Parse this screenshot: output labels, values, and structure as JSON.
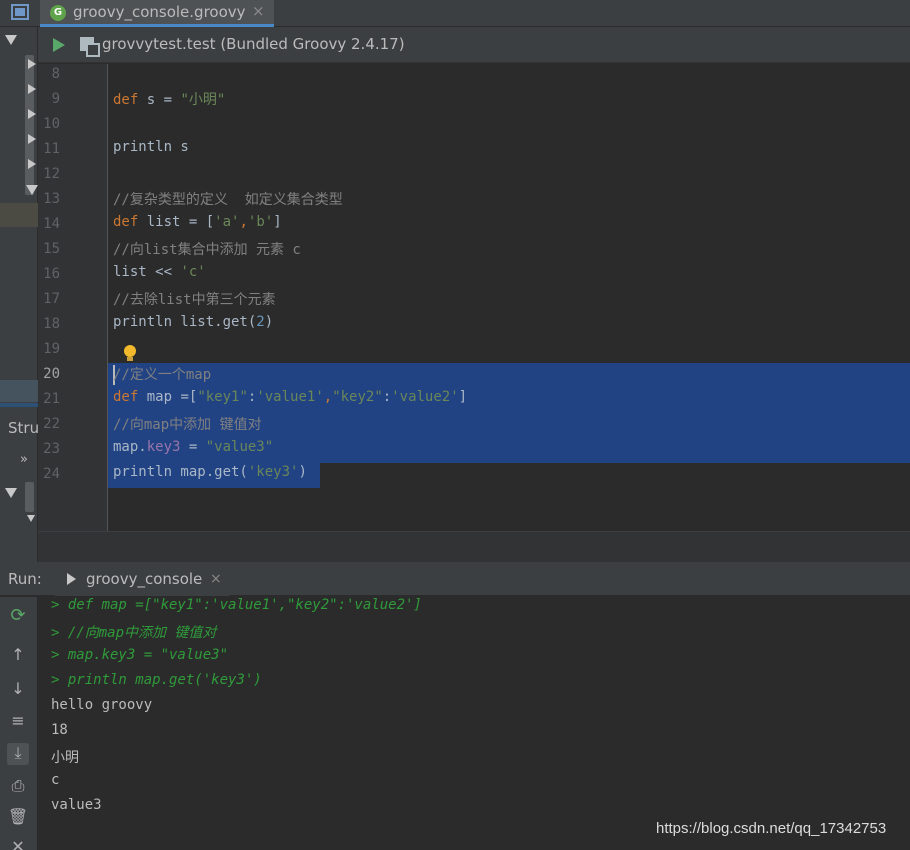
{
  "window": {
    "tab_title": "groovy_console.groovy",
    "tab_close": "×"
  },
  "run_config": {
    "label": "grovvytest.test (Bundled Groovy 2.4.17)"
  },
  "left_panel": {
    "structure_label": "Stru",
    "chevron": "»"
  },
  "editor": {
    "lines": [
      {
        "num": "8",
        "tokens": []
      },
      {
        "num": "9",
        "tokens": [
          {
            "t": "def",
            "c": "kw"
          },
          {
            "t": " s = ",
            "c": ""
          },
          {
            "t": "\"小明\"",
            "c": "str"
          }
        ]
      },
      {
        "num": "10",
        "tokens": []
      },
      {
        "num": "11",
        "tokens": [
          {
            "t": "println s",
            "c": ""
          }
        ]
      },
      {
        "num": "12",
        "tokens": []
      },
      {
        "num": "13",
        "tokens": [
          {
            "t": "//复杂类型的定义  如定义集合类型",
            "c": "cmt"
          }
        ]
      },
      {
        "num": "14",
        "tokens": [
          {
            "t": "def",
            "c": "kw"
          },
          {
            "t": " list = [",
            "c": ""
          },
          {
            "t": "'a'",
            "c": "str"
          },
          {
            "t": ",",
            "c": "kw"
          },
          {
            "t": "'b'",
            "c": "str"
          },
          {
            "t": "]",
            "c": ""
          }
        ]
      },
      {
        "num": "15",
        "tokens": [
          {
            "t": "//向list集合中添加 元素 c",
            "c": "cmt"
          }
        ]
      },
      {
        "num": "16",
        "tokens": [
          {
            "t": "list << ",
            "c": ""
          },
          {
            "t": "'c'",
            "c": "str"
          }
        ]
      },
      {
        "num": "17",
        "tokens": [
          {
            "t": "//去除list中第三个元素",
            "c": "cmt"
          }
        ]
      },
      {
        "num": "18",
        "tokens": [
          {
            "t": "println list.get(",
            "c": ""
          },
          {
            "t": "2",
            "c": "num"
          },
          {
            "t": ")",
            "c": ""
          }
        ]
      },
      {
        "num": "19",
        "tokens": []
      },
      {
        "num": "20",
        "tokens": [
          {
            "t": "//定义一个map",
            "c": "cmt"
          }
        ]
      },
      {
        "num": "21",
        "tokens": [
          {
            "t": "def",
            "c": "kw"
          },
          {
            "t": " map =[",
            "c": ""
          },
          {
            "t": "\"key1\"",
            "c": "str"
          },
          {
            "t": ":",
            "c": ""
          },
          {
            "t": "'value1'",
            "c": "str"
          },
          {
            "t": ",",
            "c": "kw"
          },
          {
            "t": "\"key2\"",
            "c": "str"
          },
          {
            "t": ":",
            "c": ""
          },
          {
            "t": "'value2'",
            "c": "str"
          },
          {
            "t": "]",
            "c": ""
          }
        ]
      },
      {
        "num": "22",
        "tokens": [
          {
            "t": "//向map中添加 键值对",
            "c": "cmt"
          }
        ]
      },
      {
        "num": "23",
        "tokens": [
          {
            "t": "map.",
            "c": ""
          },
          {
            "t": "key3",
            "c": "field"
          },
          {
            "t": " = ",
            "c": ""
          },
          {
            "t": "\"value3\"",
            "c": "str"
          }
        ]
      },
      {
        "num": "24",
        "tokens": [
          {
            "t": "println map.get(",
            "c": ""
          },
          {
            "t": "'key3'",
            "c": "str"
          },
          {
            "t": ")",
            "c": ""
          }
        ]
      }
    ],
    "current_line": "20"
  },
  "run_panel": {
    "label": "Run:",
    "tab_label": "groovy_console",
    "tab_close": "×",
    "console_lines": [
      {
        "text": "> def map =[\"key1\":'value1',\"key2\":'value2']",
        "echo": true
      },
      {
        "text": "> //向map中添加 键值对",
        "echo": true
      },
      {
        "text": "> map.key3 = \"value3\"",
        "echo": true
      },
      {
        "text": "> println map.get('key3')",
        "echo": true
      },
      {
        "text": "hello groovy",
        "echo": false
      },
      {
        "text": "18",
        "echo": false
      },
      {
        "text": "小明",
        "echo": false
      },
      {
        "text": "c",
        "echo": false
      },
      {
        "text": "value3",
        "echo": false
      }
    ],
    "toolbar_icons": [
      "rerun-icon",
      "up-arrow-icon",
      "down-arrow-icon",
      "soft-wrap-icon",
      "scroll-to-end-icon",
      "print-icon",
      "trash-icon",
      "close-icon"
    ]
  },
  "watermark": "https://blog.csdn.net/qq_17342753",
  "colors": {
    "keyword": "#cc7832",
    "string": "#6a8759",
    "comment": "#808080",
    "number": "#6897bb",
    "field": "#9876aa",
    "selection": "#214283",
    "console_echo": "#2f9b3a"
  }
}
